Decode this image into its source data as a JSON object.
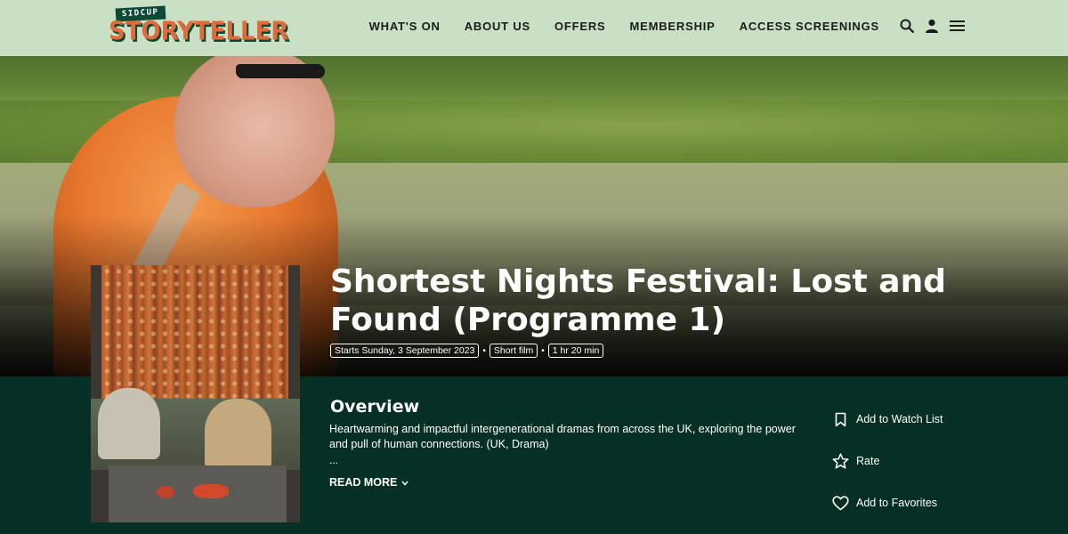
{
  "header": {
    "logo": {
      "top": "SIDCUP",
      "main": "STORYTELLER"
    },
    "nav": [
      "WHAT'S ON",
      "ABOUT US",
      "OFFERS",
      "MEMBERSHIP",
      "ACCESS SCREENINGS"
    ],
    "icons": [
      "search-icon",
      "user-icon",
      "menu-icon"
    ]
  },
  "film": {
    "title": "Shortest Nights Festival: Lost and Found (Programme 1)",
    "tags": [
      "Starts Sunday, 3 September 2023",
      "Short film",
      "1 hr 20 min"
    ]
  },
  "overview": {
    "heading": "Overview",
    "text": "Heartwarming and impactful intergenerational dramas from across the UK, exploring the power and pull of human connections. (UK, Drama)",
    "ellipsis": "...",
    "read_more": "READ MORE"
  },
  "actions": [
    {
      "label": "Add to Watch List",
      "icon": "bookmark-icon"
    },
    {
      "label": "Rate",
      "icon": "star-icon"
    },
    {
      "label": "Add to Favorites",
      "icon": "heart-icon"
    }
  ],
  "colors": {
    "header_bg": "#c9e0c4",
    "content_bg": "#062f26",
    "logo_orange": "#e06a3b",
    "logo_green": "#0b4a35"
  }
}
